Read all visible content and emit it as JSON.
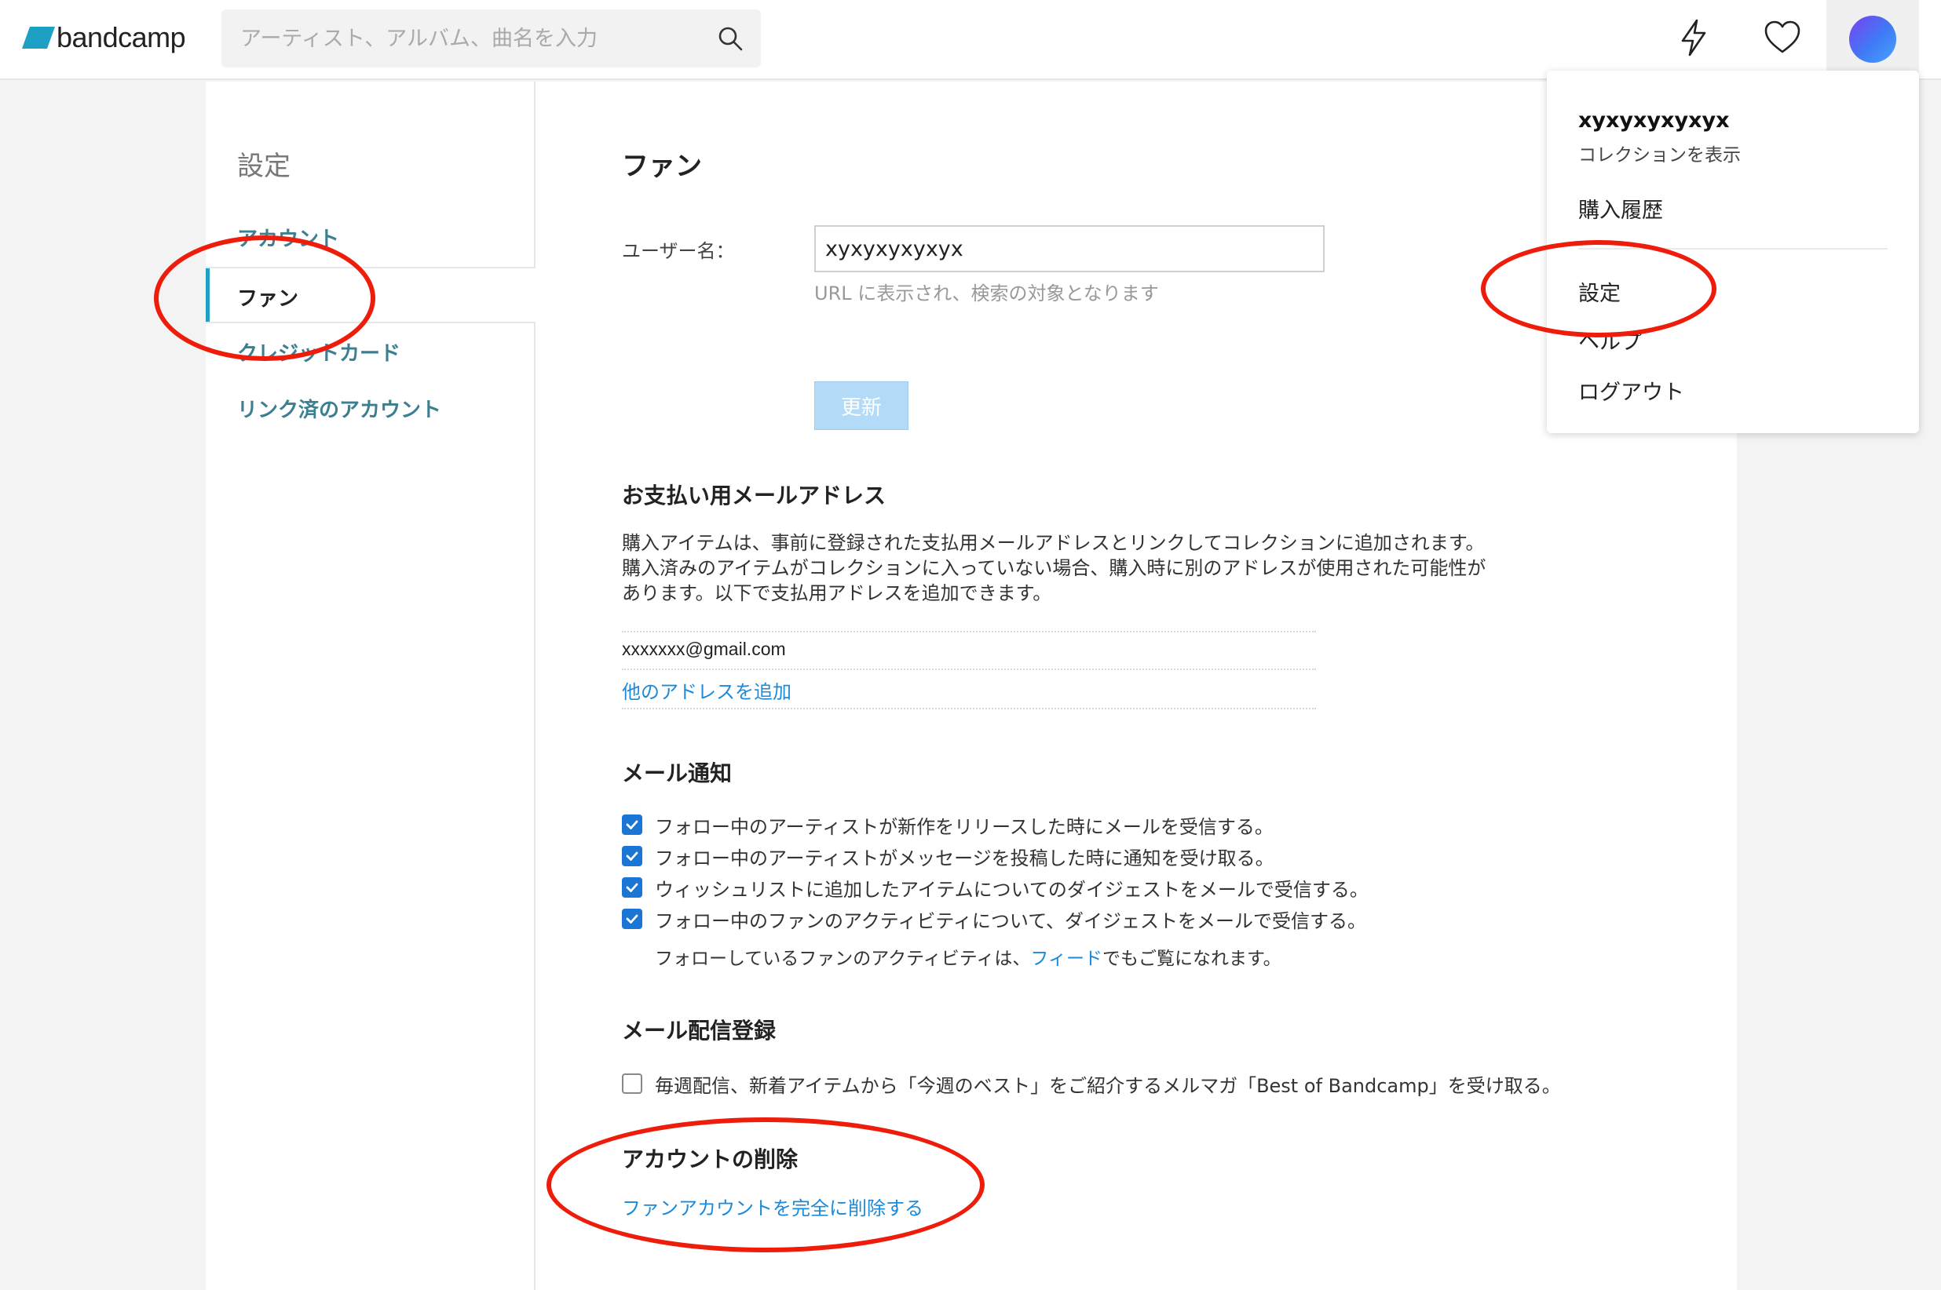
{
  "header": {
    "logo_text": "bandcamp",
    "search_placeholder": "アーティスト、アルバム、曲名を入力",
    "icons": [
      "bolt-icon",
      "heart-icon",
      "search-icon"
    ],
    "accent_color": "#1da0c3"
  },
  "sidebar": {
    "title": "設定",
    "items": [
      {
        "label": "アカウント"
      },
      {
        "label": "ファン",
        "active": true
      },
      {
        "label": "クレジットカード"
      },
      {
        "label": "リンク済のアカウント"
      }
    ]
  },
  "main": {
    "title": "ファン",
    "username_label": "ユーザー名：",
    "username_value": "xyxyxyxyxyx",
    "username_help": "URL に表示され、検索の対象となります",
    "update_button": "更新",
    "payment_email": {
      "heading": "お支払い用メールアドレス",
      "description_line1": "購入アイテムは、事前に登録された支払用メールアドレスとリンクしてコレクションに追加されます。",
      "description_line2": "購入済みのアイテムがコレクションに入っていない場合、購入時に別のアドレスが使用された可能性が",
      "description_line3": "あります。以下で支払用アドレスを追加できます。",
      "email": "xxxxxxx@gmail.com",
      "add_link": "他のアドレスを追加"
    },
    "notifications": {
      "heading": "メール通知",
      "items": [
        {
          "label": "フォロー中のアーティストが新作をリリースした時にメールを受信する。",
          "checked": true
        },
        {
          "label": "フォロー中のアーティストがメッセージを投稿した時に通知を受け取る。",
          "checked": true
        },
        {
          "label": "ウィッシュリストに追加したアイテムについてのダイジェストをメールで受信する。",
          "checked": true
        },
        {
          "label": "フォロー中のファンのアクティビティについて、ダイジェストをメールで受信する。",
          "checked": true
        }
      ],
      "note_before": "フォローしているファンのアクティビティは、",
      "note_link": "フィード",
      "note_after": "でもご覧になれます。"
    },
    "newsletter": {
      "heading": "メール配信登録",
      "label": "毎週配信、新着アイテムから「今週のベスト」をご紹介するメルマガ「Best of Bandcamp」を受け取る。",
      "checked": false
    },
    "delete_account": {
      "heading": "アカウントの削除",
      "link": "ファンアカウントを完全に削除する"
    }
  },
  "dropdown": {
    "username": "xyxyxyxyxyx",
    "view_collection": "コレクションを表示",
    "purchase_history": "購入履歴",
    "settings": "設定",
    "help": "ヘルプ",
    "logout": "ログアウト"
  },
  "annotation_color": "#ee1c0b"
}
